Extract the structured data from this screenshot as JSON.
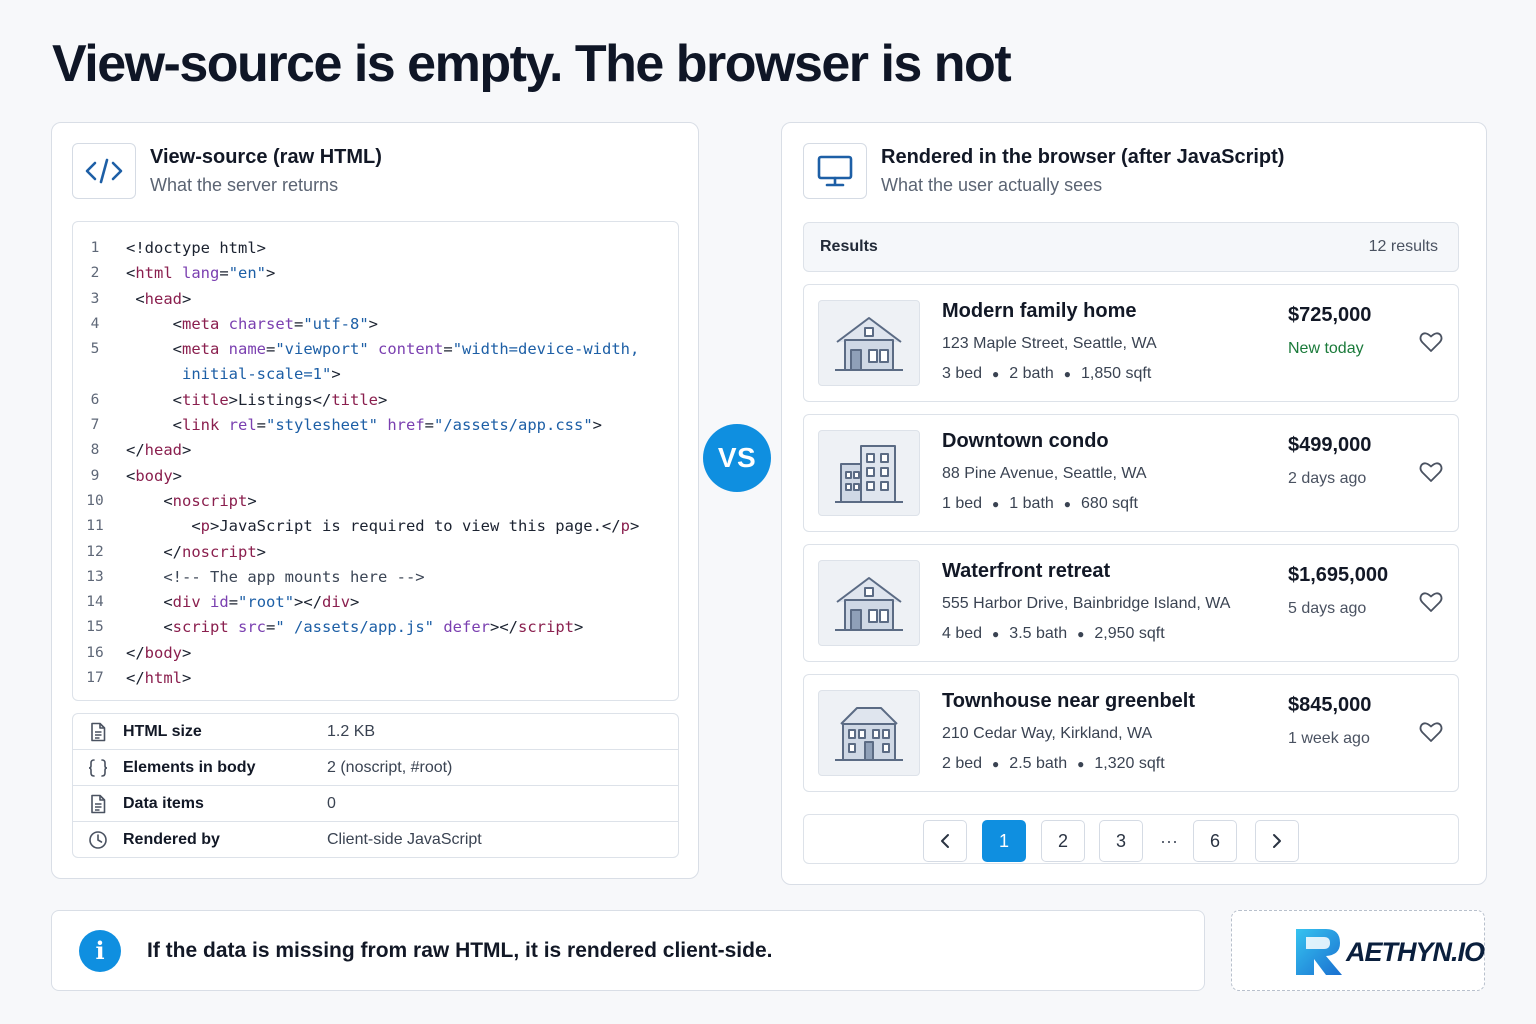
{
  "page": {
    "title": "View-source is empty. The browser is not"
  },
  "left_panel": {
    "title": "View-source (raw HTML)",
    "subtitle": "What the server returns",
    "icon": "code-icon",
    "code_lines": [
      {
        "n": "1",
        "html": "<span class=\"pun\">&lt;!doctype html&gt;</span>"
      },
      {
        "n": "2",
        "html": "&lt;<span class=\"tag\">html</span> <span class=\"attr\">lang</span>=<span class=\"val\">\"en\"</span>&gt;"
      },
      {
        "n": "3",
        "html": " &lt;<span class=\"tag\">head</span>&gt;"
      },
      {
        "n": "4",
        "html": "     &lt;<span class=\"tag\">meta</span> <span class=\"attr\">charset</span>=<span class=\"val\">\"utf-8\"</span>&gt;"
      },
      {
        "n": "5",
        "html": "     &lt;<span class=\"tag\">meta</span> <span class=\"attr\">name</span>=<span class=\"val\">\"viewport\"</span> <span class=\"attr\">content</span>=<span class=\"val\">\"width=device-width,</span>"
      },
      {
        "n": "",
        "html": "      <span class=\"val\">initial-scale=1\"</span>&gt;"
      },
      {
        "n": "6",
        "html": "     &lt;<span class=\"tag\">title</span>&gt;Listings&lt;/<span class=\"tag\">title</span>&gt;"
      },
      {
        "n": "7",
        "html": "     &lt;<span class=\"tag\">link</span> <span class=\"attr\">rel</span>=<span class=\"val\">\"stylesheet\"</span> <span class=\"attr\">href</span>=<span class=\"val\">\"/assets/app.css\"</span>&gt;"
      },
      {
        "n": "8",
        "html": "&lt;/<span class=\"tag\">head</span>&gt;"
      },
      {
        "n": "9",
        "html": "&lt;<span class=\"tag\">body</span>&gt;"
      },
      {
        "n": "10",
        "html": "    &lt;<span class=\"tag\">noscript</span>&gt;"
      },
      {
        "n": "11",
        "html": "       &lt;<span class=\"tag\">p</span>&gt;JavaScript is required to view this page.&lt;/<span class=\"tag\">p</span>&gt;"
      },
      {
        "n": "12",
        "html": "    &lt;/<span class=\"tag\">noscript</span>&gt;"
      },
      {
        "n": "13",
        "html": "    <span class=\"cmt\">&lt;!-- The app mounts here --&gt;</span>"
      },
      {
        "n": "14",
        "html": "    &lt;<span class=\"tag\">div</span> <span class=\"attr\">id</span>=<span class=\"val\">\"root\"</span>&gt;&lt;/<span class=\"tag\">div</span>&gt;"
      },
      {
        "n": "15",
        "html": "    &lt;<span class=\"tag\">script</span> <span class=\"attr\">src</span>=<span class=\"val\">\" /assets/app.js\"</span> <span class=\"attr\">defer</span>&gt;&lt;/<span class=\"tag\">script</span>&gt;"
      },
      {
        "n": "16",
        "html": "&lt;/<span class=\"tag\">body</span>&gt;"
      },
      {
        "n": "17",
        "html": "&lt;/<span class=\"tag\">html</span>&gt;"
      }
    ],
    "info": [
      {
        "icon": "file-icon",
        "label": "HTML size",
        "value": "1.2 KB"
      },
      {
        "icon": "braces-icon",
        "label": "Elements in body",
        "value": "2 (noscript, #root)"
      },
      {
        "icon": "file-icon",
        "label": "Data items",
        "value": "0"
      },
      {
        "icon": "clock-icon",
        "label": "Rendered by",
        "value": "Client-side JavaScript"
      }
    ]
  },
  "vs_label": "VS",
  "right_panel": {
    "title": "Rendered in the browser (after JavaScript)",
    "subtitle": "What the user actually sees",
    "icon": "monitor-icon",
    "results_label": "Results",
    "results_count": "12 results",
    "listings": [
      {
        "title": "Modern family home",
        "address": "123 Maple Street, Seattle, WA",
        "beds": "3 bed",
        "baths": "2 bath",
        "sqft": "1,850 sqft",
        "price": "$725,000",
        "when": "New today",
        "is_new": true,
        "icon": "house-icon"
      },
      {
        "title": "Downtown condo",
        "address": "88 Pine Avenue, Seattle, WA",
        "beds": "1 bed",
        "baths": "1 bath",
        "sqft": "680 sqft",
        "price": "$499,000",
        "when": "2 days ago",
        "is_new": false,
        "icon": "building-icon"
      },
      {
        "title": "Waterfront retreat",
        "address": "555 Harbor Drive, Bainbridge Island, WA",
        "beds": "4 bed",
        "baths": "3.5 bath",
        "sqft": "2,950 sqft",
        "price": "$1,695,000",
        "when": "5 days ago",
        "is_new": false,
        "icon": "house-icon"
      },
      {
        "title": "Townhouse near greenbelt",
        "address": "210 Cedar Way, Kirkland, WA",
        "beds": "2 bed",
        "baths": "2.5 bath",
        "sqft": "1,320 sqft",
        "price": "$845,000",
        "when": "1 week ago",
        "is_new": false,
        "icon": "townhouse-icon"
      }
    ],
    "pagination": {
      "prev": "‹",
      "pages": [
        "1",
        "2",
        "3"
      ],
      "ellipsis": "···",
      "last": "6",
      "next": "›",
      "active": "1"
    }
  },
  "note": {
    "icon": "i",
    "text": "If the data is missing from raw HTML, it is rendered client-side."
  },
  "logo": {
    "text": "AETHYN.IO"
  },
  "colors": {
    "accent": "#0f8fe0",
    "new_green": "#1a7a3a",
    "text": "#121826"
  }
}
